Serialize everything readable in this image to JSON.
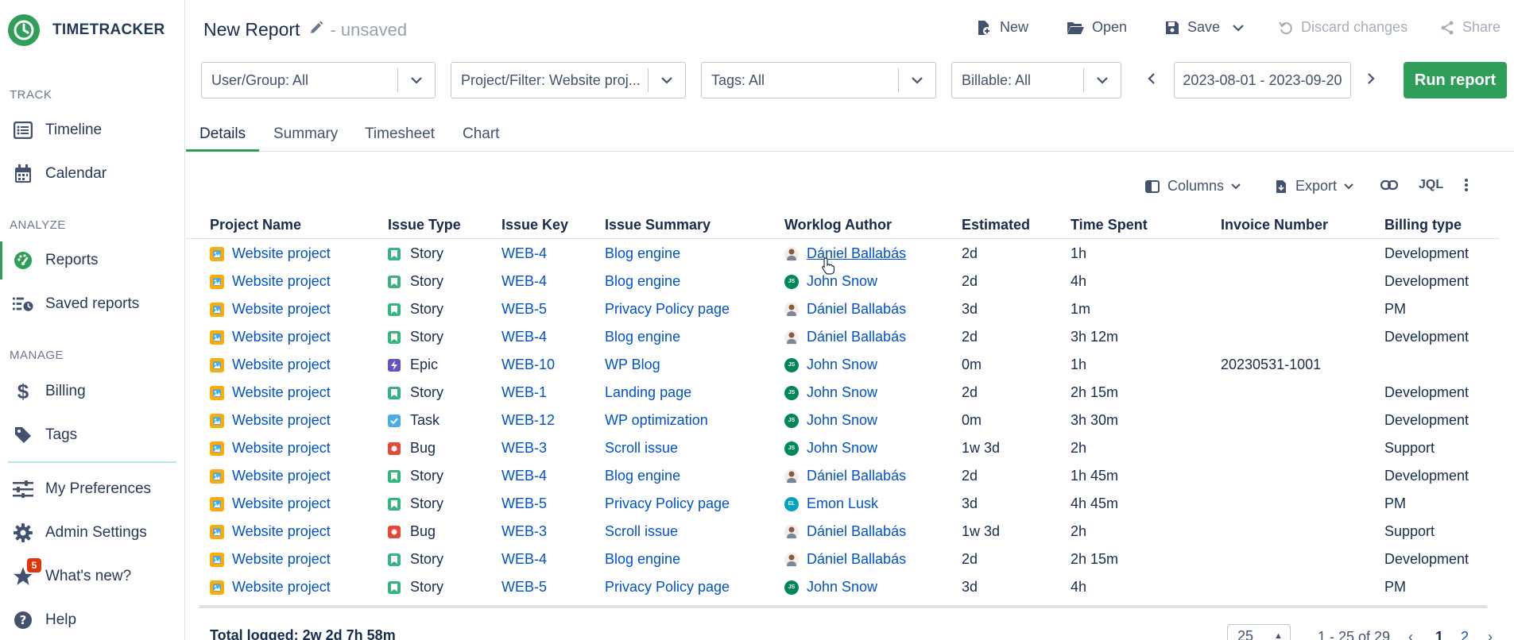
{
  "brand": {
    "name": "TIMETRACKER"
  },
  "sidebar": {
    "sections": {
      "track": "TRACK",
      "analyze": "ANALYZE",
      "manage": "MANAGE"
    },
    "items": [
      {
        "label": "Timeline",
        "icon": "list-icon"
      },
      {
        "label": "Calendar",
        "icon": "calendar-icon"
      },
      {
        "label": "Reports",
        "icon": "gauge-icon"
      },
      {
        "label": "Saved reports",
        "icon": "saved-reports-icon"
      },
      {
        "label": "Billing",
        "icon": "dollar-icon"
      },
      {
        "label": "Tags",
        "icon": "tag-icon"
      },
      {
        "label": "My Preferences",
        "icon": "sliders-icon"
      },
      {
        "label": "Admin Settings",
        "icon": "gear-icon"
      },
      {
        "label": "What's new?",
        "icon": "star-icon",
        "badge": "5"
      },
      {
        "label": "Help",
        "icon": "help-icon"
      }
    ]
  },
  "header": {
    "title": "New Report",
    "status": "- unsaved",
    "new_label": "New",
    "open_label": "Open",
    "save_label": "Save",
    "discard_label": "Discard changes",
    "share_label": "Share"
  },
  "filters": {
    "user_group": "User/Group: All",
    "project_filter": "Project/Filter: Website proj...",
    "tags": "Tags: All",
    "billable": "Billable: All",
    "date_range": "2023-08-01 - 2023-09-20",
    "run_label": "Run report"
  },
  "tabs": [
    "Details",
    "Summary",
    "Timesheet",
    "Chart"
  ],
  "table_actions": {
    "columns_label": "Columns",
    "export_label": "Export",
    "jql_label": "JQL"
  },
  "table": {
    "headers": [
      "Project Name",
      "Issue Type",
      "Issue Key",
      "Issue Summary",
      "Worklog Author",
      "Estimated",
      "Time Spent",
      "Invoice Number",
      "Billing type"
    ],
    "rows": [
      {
        "project": "Website project",
        "type": "Story",
        "key": "WEB-4",
        "summary": "Blog engine",
        "author": "Dániel Ballabás",
        "av": "photo",
        "estimated": "2d",
        "spent": "1h",
        "invoice": "",
        "billing": "Development"
      },
      {
        "project": "Website project",
        "type": "Story",
        "key": "WEB-4",
        "summary": "Blog engine",
        "author": "John Snow",
        "av": "JS",
        "estimated": "2d",
        "spent": "4h",
        "invoice": "",
        "billing": "Development"
      },
      {
        "project": "Website project",
        "type": "Story",
        "key": "WEB-5",
        "summary": "Privacy Policy page",
        "author": "Dániel Ballabás",
        "av": "photo",
        "estimated": "3d",
        "spent": "1m",
        "invoice": "",
        "billing": "PM"
      },
      {
        "project": "Website project",
        "type": "Story",
        "key": "WEB-4",
        "summary": "Blog engine",
        "author": "Dániel Ballabás",
        "av": "photo",
        "estimated": "2d",
        "spent": "3h 12m",
        "invoice": "",
        "billing": "Development"
      },
      {
        "project": "Website project",
        "type": "Epic",
        "key": "WEB-10",
        "summary": "WP Blog",
        "author": "John Snow",
        "av": "JS",
        "estimated": "0m",
        "spent": "1h",
        "invoice": "20230531-1001",
        "billing": ""
      },
      {
        "project": "Website project",
        "type": "Story",
        "key": "WEB-1",
        "summary": "Landing page",
        "author": "John Snow",
        "av": "JS",
        "estimated": "2d",
        "spent": "2h 15m",
        "invoice": "",
        "billing": "Development"
      },
      {
        "project": "Website project",
        "type": "Task",
        "key": "WEB-12",
        "summary": "WP optimization",
        "author": "John Snow",
        "av": "JS",
        "estimated": "0m",
        "spent": "3h 30m",
        "invoice": "",
        "billing": "Development"
      },
      {
        "project": "Website project",
        "type": "Bug",
        "key": "WEB-3",
        "summary": "Scroll issue",
        "author": "John Snow",
        "av": "JS",
        "estimated": "1w 3d",
        "spent": "2h",
        "invoice": "",
        "billing": "Support"
      },
      {
        "project": "Website project",
        "type": "Story",
        "key": "WEB-4",
        "summary": "Blog engine",
        "author": "Dániel Ballabás",
        "av": "photo",
        "estimated": "2d",
        "spent": "1h 45m",
        "invoice": "",
        "billing": "Development"
      },
      {
        "project": "Website project",
        "type": "Story",
        "key": "WEB-5",
        "summary": "Privacy Policy page",
        "author": "Emon Lusk",
        "av": "EL",
        "estimated": "3d",
        "spent": "4h 45m",
        "invoice": "",
        "billing": "PM"
      },
      {
        "project": "Website project",
        "type": "Bug",
        "key": "WEB-3",
        "summary": "Scroll issue",
        "author": "Dániel Ballabás",
        "av": "photo",
        "estimated": "1w 3d",
        "spent": "2h",
        "invoice": "",
        "billing": "Support"
      },
      {
        "project": "Website project",
        "type": "Story",
        "key": "WEB-4",
        "summary": "Blog engine",
        "author": "Dániel Ballabás",
        "av": "photo",
        "estimated": "2d",
        "spent": "2h 15m",
        "invoice": "",
        "billing": "Development"
      },
      {
        "project": "Website project",
        "type": "Story",
        "key": "WEB-5",
        "summary": "Privacy Policy page",
        "author": "John Snow",
        "av": "JS",
        "estimated": "3d",
        "spent": "4h",
        "invoice": "",
        "billing": "PM"
      }
    ]
  },
  "footer": {
    "total": "Total logged: 2w 2d 7h 58m",
    "page_size": "25",
    "page_info": "1 - 25 of 29",
    "page_current": "1",
    "page_next": "2"
  },
  "colors": {
    "brand": "#2e9e58",
    "link": "#0052cc",
    "story": "#36b37e",
    "epic": "#6554c0",
    "task": "#4bade8",
    "bug": "#e5493a",
    "badge": "#de350b"
  }
}
